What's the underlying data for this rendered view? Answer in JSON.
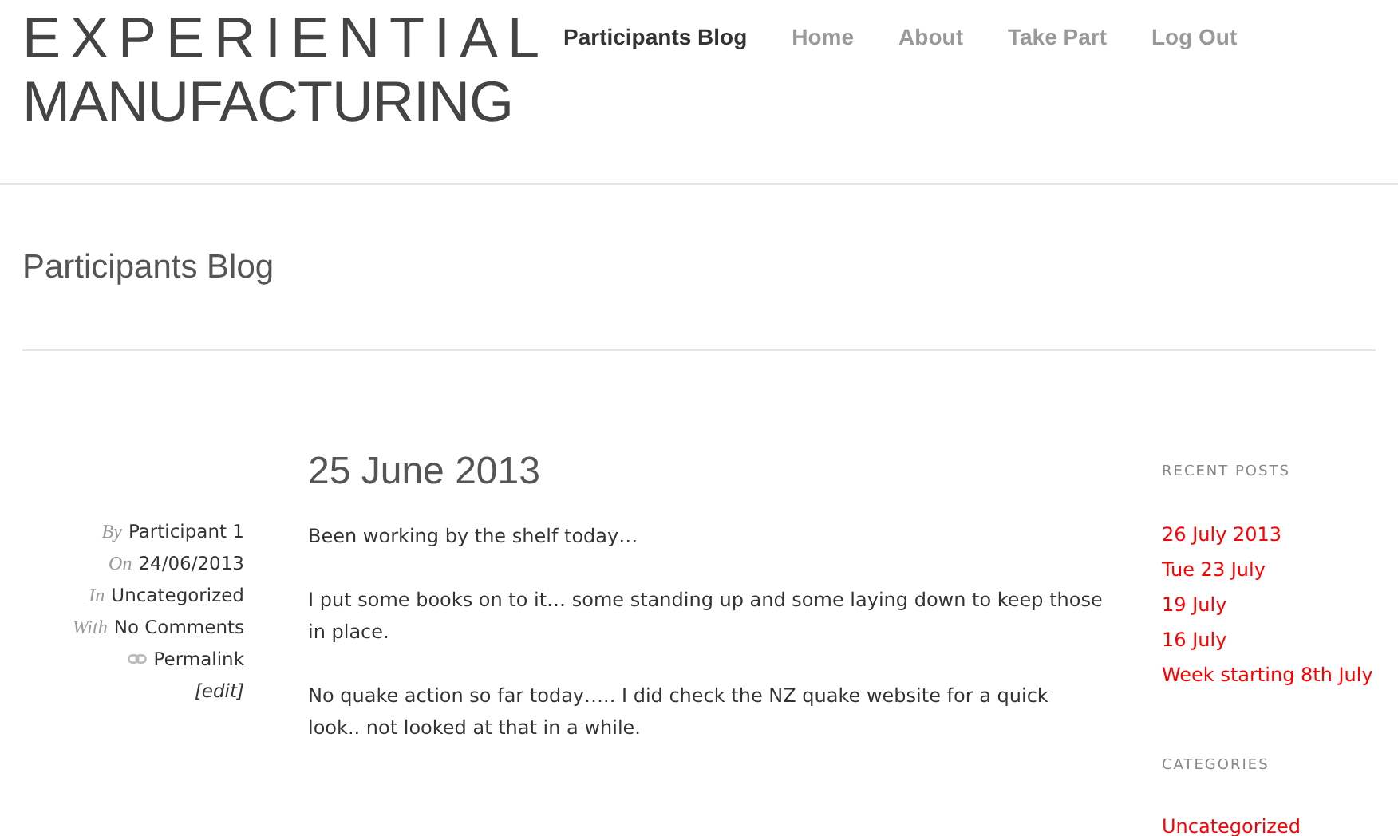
{
  "logo": {
    "line_1": "EXPERIENTIAL",
    "line_2": "MANUFACTURING"
  },
  "nav": [
    {
      "label": "Participants Blog",
      "selected": true
    },
    {
      "label": "Home",
      "selected": false
    },
    {
      "label": "About",
      "selected": false
    },
    {
      "label": "Take Part",
      "selected": false
    },
    {
      "label": "Log Out",
      "selected": false
    }
  ],
  "page_title": "Participants Blog",
  "post": {
    "title": "25 June 2013",
    "meta": [
      {
        "kind": "labeled",
        "label": "By",
        "value": "Participant 1"
      },
      {
        "kind": "labeled",
        "label": "On",
        "value": "24/06/2013"
      },
      {
        "kind": "labeled",
        "label": "In",
        "value": "Uncategorized"
      },
      {
        "kind": "labeled",
        "label": "With",
        "value": "No Comments"
      },
      {
        "kind": "permalink",
        "value": "Permalink"
      },
      {
        "kind": "edit",
        "value": "[edit]"
      }
    ],
    "paragraphs": [
      "Been working by the shelf today…",
      "I put some books on to it… some standing up and some laying down to keep those in place.",
      "No quake action so far today….. I did check the NZ quake website for a quick look.. not looked at that in a while."
    ]
  },
  "sidebar": [
    {
      "heading": "RECENT POSTS",
      "links": [
        "26 July 2013",
        "Tue 23 July",
        "19 July",
        "16 July",
        "Week starting 8th July"
      ]
    },
    {
      "heading": "CATEGORIES",
      "links": [
        "Uncategorized"
      ]
    }
  ]
}
